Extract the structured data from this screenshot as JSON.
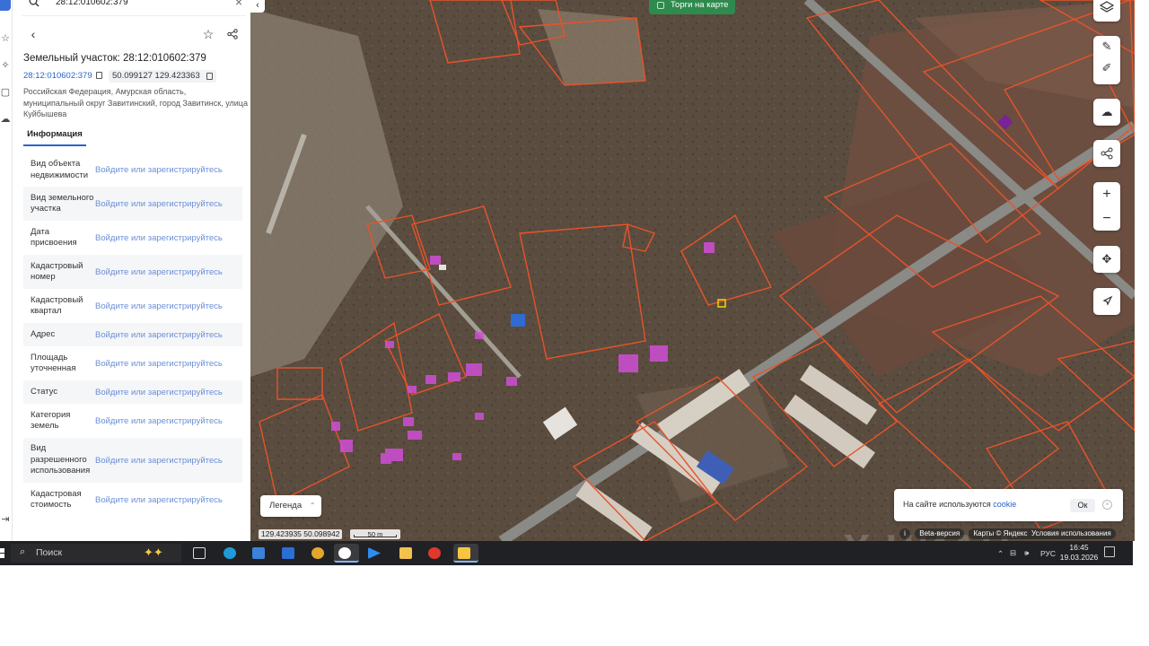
{
  "search": {
    "value": "28:12:010602:379"
  },
  "parcel": {
    "title": "Земельный участок: 28:12:010602:379",
    "cadastral_number": "28:12:010602:379",
    "coordinates": "50.099127 129.423363",
    "address": "Российская Федерация, Амурская область, муниципальный округ Завитинский, город Завитинск, улица Куйбышева"
  },
  "tabs": {
    "info": "Информация"
  },
  "info_rows": [
    {
      "label": "Вид объекта недвижимости",
      "value": "Войдите или зарегистрируйтесь"
    },
    {
      "label": "Вид земельного участка",
      "value": "Войдите или зарегистрируйтесь"
    },
    {
      "label": "Дата присвоения",
      "value": "Войдите или зарегистрируйтесь"
    },
    {
      "label": "Кадастровый номер",
      "value": "Войдите или зарегистрируйтесь"
    },
    {
      "label": "Кадастровый квартал",
      "value": "Войдите или зарегистрируйтесь"
    },
    {
      "label": "Адрес",
      "value": "Войдите или зарегистрируйтесь"
    },
    {
      "label": "Площадь уточненная",
      "value": "Войдите или зарегистрируйтесь"
    },
    {
      "label": "Статус",
      "value": "Войдите или зарегистрируйтесь"
    },
    {
      "label": "Категория земель",
      "value": "Войдите или зарегистрируйтесь"
    },
    {
      "label": "Вид разрешенного использования",
      "value": "Войдите или зарегистрируйтесь"
    },
    {
      "label": "Кадастровая стоимость",
      "value": "Войдите или зарегистрируйтесь"
    }
  ],
  "map": {
    "torgi_label": "Торги на карте",
    "legend_label": "Легенда",
    "cursor_coords": "129.423935   50.098942",
    "scale_label": "50 m",
    "beta_label": "Beta-версия",
    "attribution": "Карты © Яндекс",
    "terms": "Условия использования",
    "watermark": "Х ЦИАН"
  },
  "cookie": {
    "text": "На сайте используются ",
    "link": "cookie",
    "ok": "Ок"
  },
  "taskbar": {
    "search_placeholder": "Поиск",
    "lang": "РУС",
    "time": "16:45",
    "date": "19.03.2026"
  },
  "colors": {
    "accent": "#2b64c8",
    "parcel_outline": "#e8532a",
    "parcel_highlight": "#d04fd6",
    "torgi_green": "#2f8a4e"
  }
}
